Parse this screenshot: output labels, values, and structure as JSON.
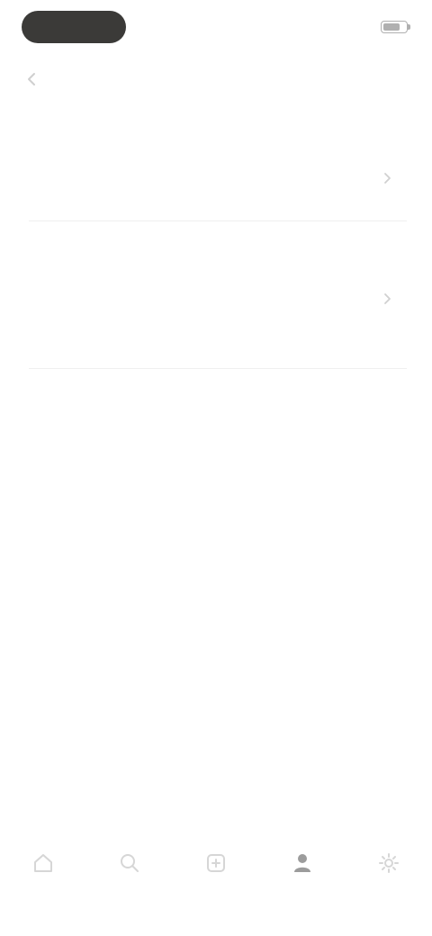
{
  "status_bar": {
    "time": "",
    "colors": {
      "pill": "#3b3a38"
    }
  },
  "header": {
    "title": "",
    "back_icon": "chevron-left-icon"
  },
  "list": {
    "items": [
      {
        "title": "",
        "description": "",
        "icon": "chevron-right-icon"
      },
      {
        "title": "",
        "description": "",
        "icon": "chevron-right-icon"
      }
    ]
  },
  "bottom_nav": {
    "items": [
      {
        "icon": "home-icon",
        "label": "",
        "active": false
      },
      {
        "icon": "search-icon",
        "label": "",
        "active": false
      },
      {
        "icon": "add-icon",
        "label": "",
        "active": false
      },
      {
        "icon": "profile-icon",
        "label": "",
        "active": true
      },
      {
        "icon": "settings-icon",
        "label": "",
        "active": false
      }
    ]
  }
}
